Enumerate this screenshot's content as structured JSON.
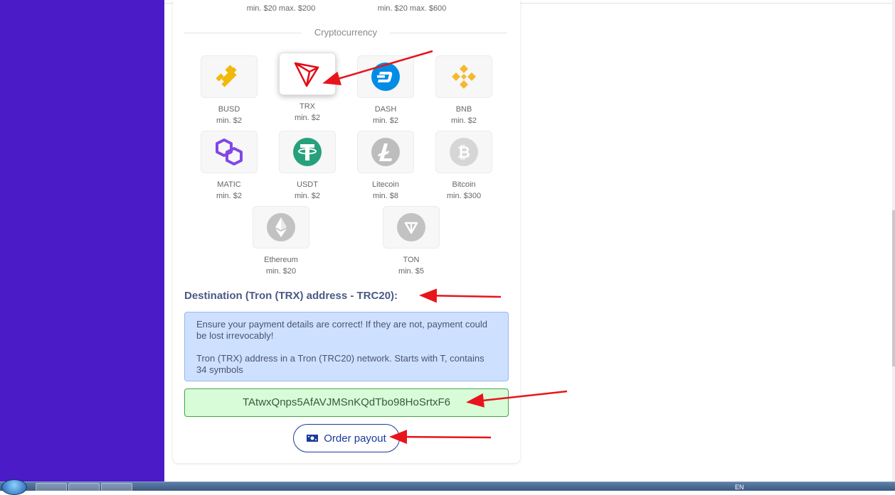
{
  "fiat_limits": {
    "left": "min. $20 max. $200",
    "right": "min. $20 max. $600"
  },
  "section_title": "Cryptocurrency",
  "coins": [
    {
      "name": "BUSD",
      "min": "min. $2",
      "icon": "busd-icon",
      "color": "#f0b90b"
    },
    {
      "name": "TRX",
      "min": "min. $2",
      "icon": "tron-icon",
      "color": "#e50914",
      "selected": true
    },
    {
      "name": "DASH",
      "min": "min. $2",
      "icon": "dash-icon",
      "color": "#008ce7"
    },
    {
      "name": "BNB",
      "min": "min. $2",
      "icon": "bnb-icon",
      "color": "#f3ba2f"
    },
    {
      "name": "MATIC",
      "min": "min. $2",
      "icon": "polygon-icon",
      "color": "#8247e5"
    },
    {
      "name": "USDT",
      "min": "min. $2",
      "icon": "tether-icon",
      "color": "#26a17b"
    },
    {
      "name": "Litecoin",
      "min": "min. $8",
      "icon": "litecoin-icon",
      "color": "#bdbdbd"
    },
    {
      "name": "Bitcoin",
      "min": "min. $300",
      "icon": "bitcoin-icon",
      "color": "#d6d6d6"
    },
    {
      "name": "Ethereum",
      "min": "min. $20",
      "icon": "ethereum-icon",
      "color": "#c2c2c2"
    },
    {
      "name": "TON",
      "min": "min. $5",
      "icon": "ton-icon",
      "color": "#c2c2c2"
    }
  ],
  "destination_label": "Destination (Tron (TRX) address - TRC20):",
  "info": {
    "warning": "Ensure your payment details are correct! If they are not, payment could be lost irrevocably!",
    "hint": "Tron (TRX) address in a Tron (TRC20) network. Starts with T, contains 34 symbols"
  },
  "address_value": "TAtwxQnps5AfAVJMSnKQdTbo98HoSrtxF6",
  "order_button": {
    "label": "Order payout",
    "icon": "banknote-icon"
  },
  "taskbar": {
    "lang": "EN"
  },
  "colors": {
    "sidebar": "#4a1bc7",
    "arrow": "#e8141b",
    "button": "#1a3a9c"
  }
}
